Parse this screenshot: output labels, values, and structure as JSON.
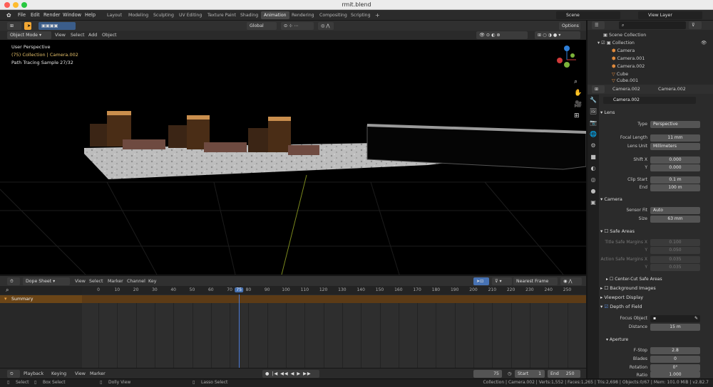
{
  "window": {
    "title": "rmit.blend"
  },
  "menu": [
    "File",
    "Edit",
    "Render",
    "Window",
    "Help"
  ],
  "workspaces": [
    "Layout",
    "Modeling",
    "Sculpting",
    "UV Editing",
    "Texture Paint",
    "Shading",
    "Animation",
    "Rendering",
    "Compositing",
    "Scripting"
  ],
  "active_workspace": "Animation",
  "scene": "Scene",
  "view_layer": "View Layer",
  "viewport": {
    "mode": "Object Mode",
    "menus": [
      "View",
      "Select",
      "Add",
      "Object"
    ],
    "orientation": "Global",
    "options": "Options",
    "overlay_lines": [
      "User Perspective",
      "(75) Collection | Camera.002",
      "Path Tracing Sample 27/32"
    ]
  },
  "dopesheet": {
    "editor": "Dope Sheet",
    "menus": [
      "View",
      "Select",
      "Marker",
      "Channel",
      "Key"
    ],
    "snap": "Nearest Frame",
    "summary": "Summary",
    "ticks": [
      "0",
      "10",
      "20",
      "30",
      "40",
      "50",
      "60",
      "70",
      "75",
      "80",
      "90",
      "100",
      "110",
      "120",
      "130",
      "140",
      "150",
      "160",
      "170",
      "180",
      "190",
      "200",
      "210",
      "220",
      "230",
      "240",
      "250"
    ]
  },
  "timeline": {
    "playback": "Playback",
    "keying": "Keying",
    "view": "View",
    "marker": "Marker",
    "current": "75",
    "start_label": "Start",
    "start": "1",
    "end_label": "End",
    "end": "250"
  },
  "status": {
    "select": "Select",
    "box": "Box Select",
    "dolly": "Dolly View",
    "lasso": "Lasso Select",
    "info": "Collection | Camera.002 | Verts:1,552 | Faces:1,265 | Tris:2,698 | Objects:0/67 | Mem: 101.0 MiB | v2.82.7"
  },
  "outliner": {
    "root": "Scene Collection",
    "collection": "Collection",
    "items": [
      "Camera",
      "Camera.001",
      "Camera.002",
      "Cube",
      "Cube.001"
    ]
  },
  "properties": {
    "breadcrumb_obj": "Camera.002",
    "breadcrumb_data": "Camera.002",
    "datablock": "Camera.002",
    "lens": {
      "title": "Lens",
      "type_label": "Type",
      "type": "Perspective",
      "focal_label": "Focal Length",
      "focal": "11 mm",
      "unit_label": "Lens Unit",
      "unit": "Millimeters",
      "shiftx_label": "Shift X",
      "shiftx": "0.000",
      "shifty_label": "Y",
      "shifty": "0.000",
      "clip_label": "Clip Start",
      "clip": "0.1 m",
      "end_label": "End",
      "end": "100 m"
    },
    "camera": {
      "title": "Camera",
      "fit_label": "Sensor Fit",
      "fit": "Auto",
      "size_label": "Size",
      "size": "63 mm"
    },
    "safe": {
      "title": "Safe Areas",
      "t1": "Title Safe Margins X",
      "v1": "0.100",
      "t2": "Y",
      "v2": "0.050",
      "t3": "Action Safe Margins X",
      "v3": "0.035",
      "t4": "Y",
      "v4": "0.035",
      "center": "Center-Cut Safe Areas"
    },
    "bg": "Background Images",
    "display": "Viewport Display",
    "dof": {
      "title": "Depth of Field",
      "focus_label": "Focus Object",
      "dist_label": "Distance",
      "dist": "15 m",
      "aperture": "Aperture",
      "fstop_label": "F-Stop",
      "fstop": "2.8",
      "blades_label": "Blades",
      "blades": "0",
      "rot_label": "Rotation",
      "rot": "0°",
      "ratio_label": "Ratio",
      "ratio": "1.000"
    }
  }
}
